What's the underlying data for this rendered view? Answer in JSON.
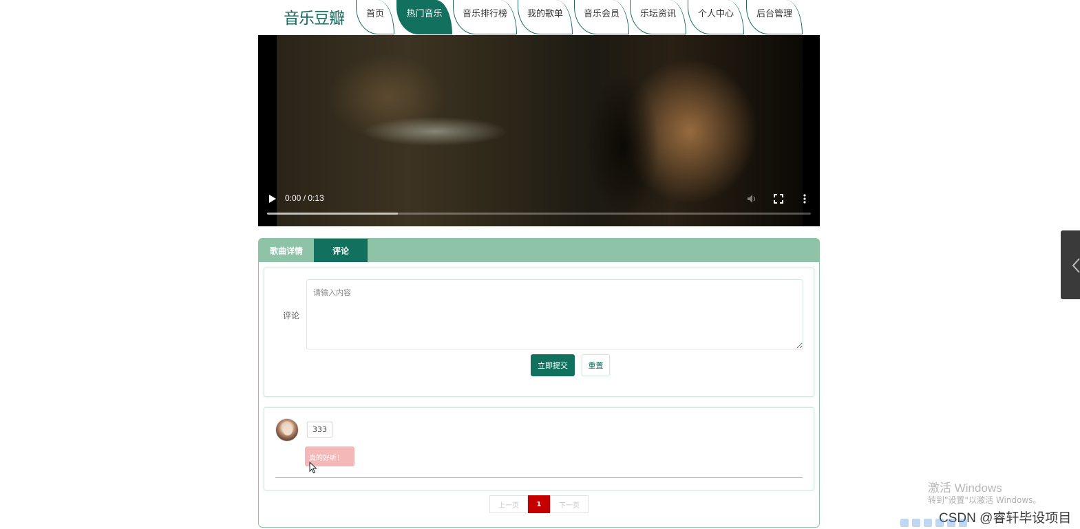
{
  "header": {
    "logo": "音乐豆瓣",
    "nav": [
      {
        "label": "首页",
        "active": false
      },
      {
        "label": "热门音乐",
        "active": true
      },
      {
        "label": "音乐排行榜",
        "active": false
      },
      {
        "label": "我的歌单",
        "active": false
      },
      {
        "label": "音乐会员",
        "active": false
      },
      {
        "label": "乐坛资讯",
        "active": false
      },
      {
        "label": "个人中心",
        "active": false
      },
      {
        "label": "后台管理",
        "active": false
      }
    ]
  },
  "video": {
    "time": "0:00 / 0:13",
    "progress": 0.24
  },
  "tabs": [
    {
      "label": "歌曲详情",
      "active": false
    },
    {
      "label": "评论",
      "active": true
    }
  ],
  "comment_form": {
    "label": "评论",
    "placeholder": "请输入内容",
    "value": "",
    "submit_label": "立即提交",
    "reset_label": "重置"
  },
  "comments": [
    {
      "username": "333",
      "text": "真的好听！"
    }
  ],
  "pagination": {
    "prev": "上一页",
    "current": "1",
    "next": "下一页"
  },
  "watermark": {
    "title": "激活 Windows",
    "subtitle": "转到\"设置\"以激活 Windows。",
    "csdn": "CSDN @睿轩毕设项目"
  },
  "colors": {
    "brand": "#12705f",
    "tabbar": "#8fc3a8",
    "page_active": "#c40000",
    "comment_bubble": "#f4b8b8"
  }
}
